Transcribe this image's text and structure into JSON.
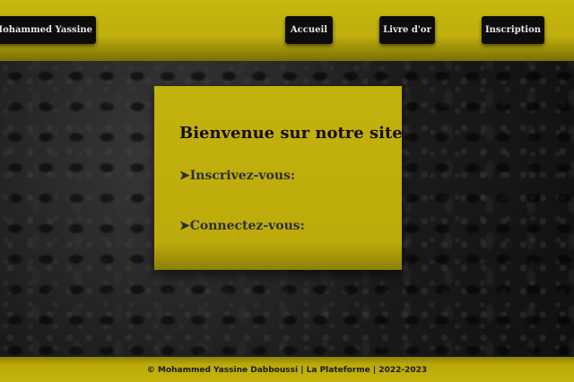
{
  "header": {
    "brand_label": "Mohammed Yassine Dabboussi",
    "nav": {
      "home_label": "Accueil",
      "guestbook_label": "Livre d'or",
      "signup_label": "Inscription"
    }
  },
  "main": {
    "title": "Bienvenue sur notre site",
    "arrow_glyph": "➤",
    "signup_link": "Inscrivez-vous:",
    "login_link": "Connectez-vous:"
  },
  "footer": {
    "text": "© Mohammed Yassine Dabboussi | La Plateforme | 2022-2023"
  },
  "colors": {
    "accent": "#c3b10c",
    "button_bg": "#0c0c0c",
    "button_text": "#e6e6e6"
  }
}
